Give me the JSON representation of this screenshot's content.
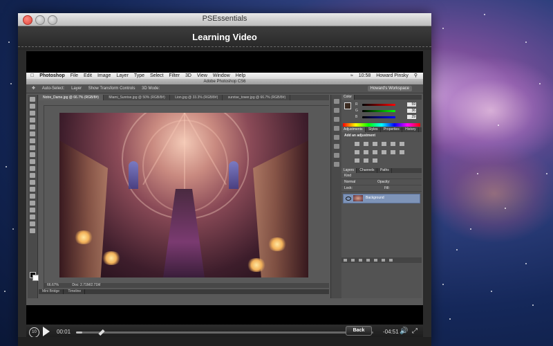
{
  "window": {
    "title": "PSEssentials",
    "header_title": "Learning Video",
    "back_label": "Back"
  },
  "photoshop": {
    "menubar": {
      "app_name": "Photoshop",
      "items": [
        "File",
        "Edit",
        "Image",
        "Layer",
        "Type",
        "Select",
        "Filter",
        "3D",
        "View",
        "Window",
        "Help"
      ],
      "clock": "10:58",
      "user": "Howard Pinsky"
    },
    "window_title": "Adobe Photoshop CS6",
    "options_bar": {
      "auto_select": "Auto-Select:",
      "layer_option": "Layer",
      "show_transform": "Show Transform Controls",
      "mode_3d": "3D Mode:",
      "workspace": "Howard's Workspace"
    },
    "doc_tabs": [
      "Notre_Dame.jpg @ 66.7% (RGB/8#)",
      "Miami_Sunrise.jpg @ 50% (RGB/8#)",
      "Lion.jpg @ 33.3% (RGB/8#)",
      "sunrise_tower.jpg @ 66.7% (RGB/8#)"
    ],
    "status": {
      "zoom": "66.67%",
      "doc": "Doc: 2.71M/2.71M"
    },
    "bottom_tabs": [
      "Mini Bridge",
      "Timeline"
    ],
    "color_panel": {
      "tabs": [
        "Color"
      ],
      "R": "59",
      "G": "36",
      "B": "29"
    },
    "adjustments_panel": {
      "tabs": [
        "Adjustments",
        "Styles",
        "Properties",
        "History"
      ],
      "heading": "Add an adjustment"
    },
    "layers_panel": {
      "tabs": [
        "Layers",
        "Channels",
        "Paths"
      ],
      "kind": "Kind",
      "blend_mode": "Normal",
      "opacity_label": "Opacity:",
      "lock_label": "Lock:",
      "fill_label": "Fill:",
      "layer_name": "Background"
    }
  },
  "player": {
    "time_elapsed": "00:01",
    "time_remaining": "-04:51",
    "progress": 0.02,
    "replay_label": "10"
  },
  "colors": {
    "accent": "#7e94b8",
    "traffic_close": "#e0443a"
  }
}
